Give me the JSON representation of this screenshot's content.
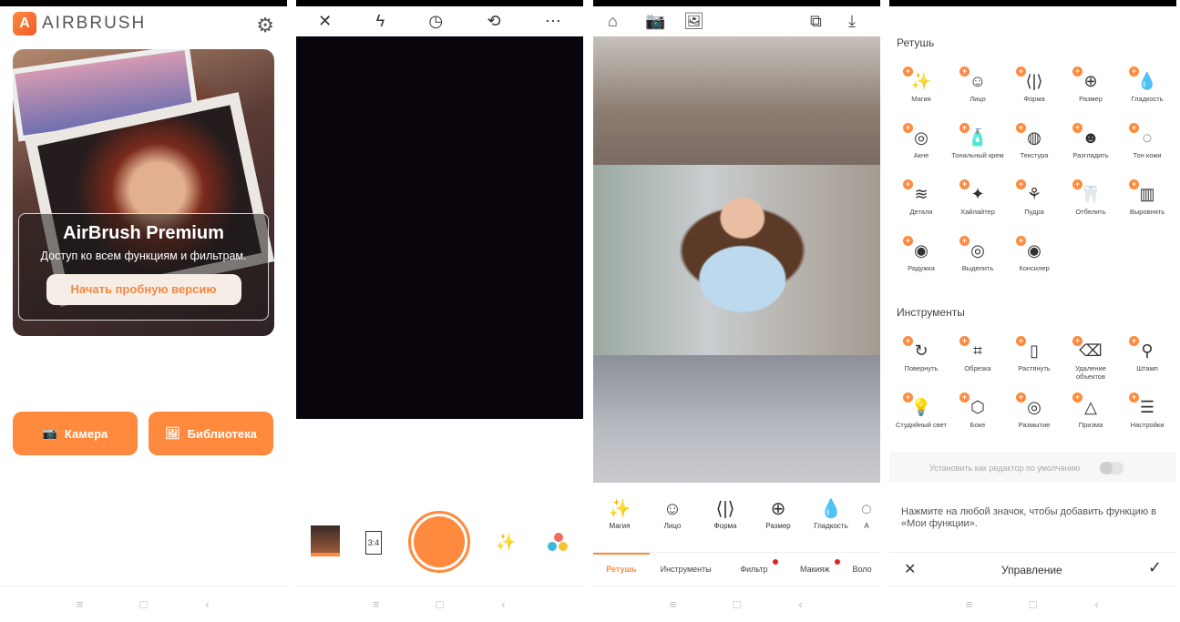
{
  "home": {
    "brand": "AIRBRUSH",
    "promo_title": "AirBrush Premium",
    "promo_sub": "Доступ ко всем функциям и фильтрам.",
    "promo_button": "Начать пробную версию",
    "camera_button": "Камера",
    "library_button": "Библиотека"
  },
  "camera": {
    "ratio": "3:4"
  },
  "editor": {
    "tools": [
      "Магия",
      "Лицо",
      "Форма",
      "Размер",
      "Гладкость",
      "А"
    ],
    "tabs": [
      "Ретушь",
      "Инструменты",
      "Фильтр",
      "Макияж",
      "Воло"
    ]
  },
  "features": {
    "retouch_title": "Ретушь",
    "retouch": [
      {
        "label": "Магия",
        "icon": "✨"
      },
      {
        "label": "Лицо",
        "icon": "☺"
      },
      {
        "label": "Форма",
        "icon": "⟨|⟩"
      },
      {
        "label": "Размер",
        "icon": "⊕"
      },
      {
        "label": "Гладкость",
        "icon": "💧"
      },
      {
        "label": "Акне",
        "icon": "◎"
      },
      {
        "label": "Тональный крем",
        "icon": "🧴"
      },
      {
        "label": "Текстура",
        "icon": "◍"
      },
      {
        "label": "Разгладить",
        "icon": "☻"
      },
      {
        "label": "Тон кожи",
        "icon": "◌"
      },
      {
        "label": "Детали",
        "icon": "≋"
      },
      {
        "label": "Хайлайтер",
        "icon": "✦"
      },
      {
        "label": "Пудра",
        "icon": "⚘"
      },
      {
        "label": "Отбелить",
        "icon": "🦷"
      },
      {
        "label": "Выровнять",
        "icon": "▥"
      },
      {
        "label": "Радужка",
        "icon": "◉"
      },
      {
        "label": "Выделить",
        "icon": "◎"
      },
      {
        "label": "Консилер",
        "icon": "◉"
      }
    ],
    "tools_title": "Инструменты",
    "tools": [
      {
        "label": "Повернуть",
        "icon": "↻"
      },
      {
        "label": "Обрезка",
        "icon": "⌗"
      },
      {
        "label": "Растянуть",
        "icon": "▯"
      },
      {
        "label": "Удаление объектов",
        "icon": "⌫"
      },
      {
        "label": "Штамп",
        "icon": "⚲"
      },
      {
        "label": "Студийный свет",
        "icon": "💡"
      },
      {
        "label": "Боке",
        "icon": "⬡"
      },
      {
        "label": "Размытие",
        "icon": "◎"
      },
      {
        "label": "Призма",
        "icon": "△"
      },
      {
        "label": "Настройки",
        "icon": "☰"
      }
    ],
    "default_editor": "Установить как редактор по умолчанию",
    "hint": "Нажмите на любой значок, чтобы добавить функцию в «Мои функции».",
    "manage": "Управление"
  }
}
